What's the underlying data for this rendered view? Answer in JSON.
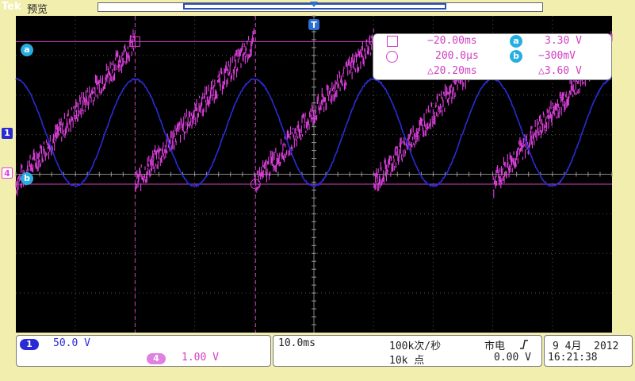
{
  "header": {
    "brand": "Tek",
    "mode": "预览"
  },
  "colors": {
    "bg": "#f2eeae",
    "ch1": "#2b2bd6",
    "ch4": "#e040e0",
    "cursor": "#d13fc2",
    "badge": "#27aee0"
  },
  "markers": {
    "cursor_a": "a",
    "cursor_b": "b",
    "ch1": "1",
    "ch4": "4",
    "trigger": "T"
  },
  "cursors": {
    "time_a": "−20.00ms",
    "time_b": "200.0µs",
    "time_delta": "△20.20ms",
    "volt_a": "3.30 V",
    "volt_b": "−300mV",
    "volt_delta": "△3.60 V",
    "badge_a": "a",
    "badge_b": "b"
  },
  "bottom": {
    "ch1_label": "1",
    "ch1_scale": "50.0 V",
    "ch4_label": "4",
    "ch4_scale": "1.00 V",
    "timebase": "10.0ms",
    "sample_rate": "100k次/秒",
    "record_length": "10k 点",
    "trigger_source": "市电",
    "trigger_slope_icon": "rising-edge-icon",
    "trigger_level": "0.00 V",
    "date": "9 4月  2012",
    "time": "16:21:38"
  },
  "chart_data": {
    "type": "line",
    "x_unit": "ms",
    "xlim": [
      -40,
      60
    ],
    "grid": true,
    "series": [
      {
        "trace": "ch1",
        "shape": "sine",
        "period_ms": 20,
        "amplitude_div": 1.35,
        "offset_div": 0.95,
        "peak_x": 0
      },
      {
        "trace": "ch4",
        "shape": "sawtooth",
        "period_ms": 20,
        "low_V": -0.3,
        "high_V": 3.3,
        "reset_x": 0
      }
    ]
  }
}
